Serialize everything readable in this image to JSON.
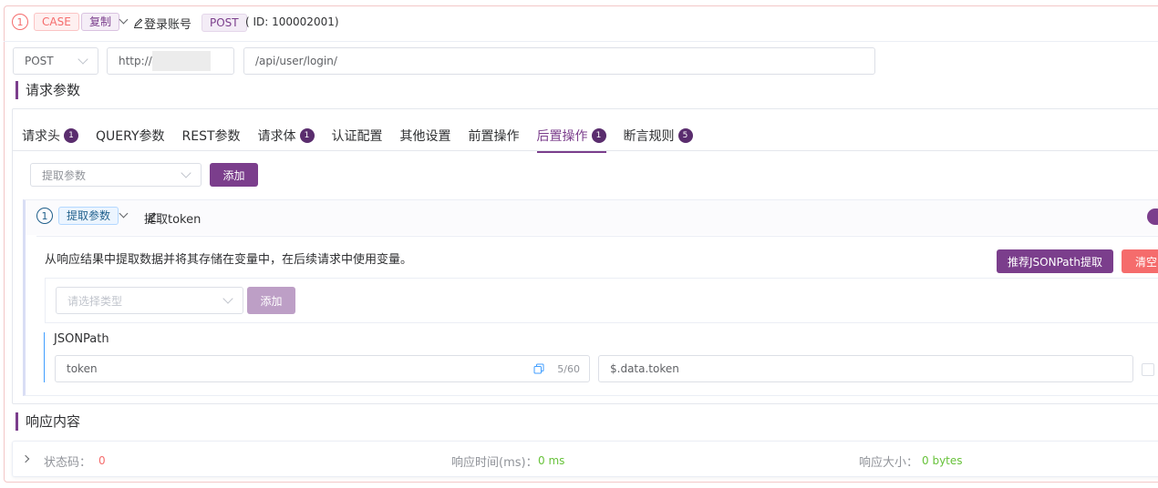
{
  "header": {
    "index": "1",
    "case_tag": "CASE",
    "copy_tag": "复制",
    "name": "登录账号",
    "method_tag": "POST",
    "id_text": "( ID: 100002001)"
  },
  "request": {
    "method": "POST",
    "base_url": "http://",
    "path": "/api/user/login/"
  },
  "params_section": {
    "title": "请求参数"
  },
  "tabs": [
    {
      "label": "请求头",
      "badge": "1"
    },
    {
      "label": "QUERY参数",
      "badge": ""
    },
    {
      "label": "REST参数",
      "badge": ""
    },
    {
      "label": "请求体",
      "badge": "1"
    },
    {
      "label": "认证配置",
      "badge": ""
    },
    {
      "label": "其他设置",
      "badge": ""
    },
    {
      "label": "前置操作",
      "badge": ""
    },
    {
      "label": "后置操作",
      "badge": "1",
      "active": true
    },
    {
      "label": "断言规则",
      "badge": "5"
    }
  ],
  "post_ops": {
    "select_value": "提取参数",
    "add_label": "添加"
  },
  "extract": {
    "index": "1",
    "type_tag": "提取参数",
    "name": "提取token",
    "description": "从响应结果中提取数据并将其存储在变量中，在后续请求中使用变量。",
    "jsonpath_button": "推荐JSONPath提取",
    "clear_button": "清空",
    "type_placeholder": "请选择类型",
    "add_label": "添加",
    "jsonpath_label": "JSONPath",
    "var_name": "token",
    "char_count": "5/60",
    "expression": "$.data.token"
  },
  "response_section": {
    "title": "响应内容",
    "status_label": "状态码：",
    "status_value": "0",
    "time_label": "响应时间(ms)：",
    "time_value": "0 ms",
    "size_label": "响应大小：",
    "size_value": "0 bytes"
  },
  "colors": {
    "accent": "#7b3e8c",
    "danger": "#f56c6c",
    "success": "#67c23a",
    "info": "#409eff"
  }
}
